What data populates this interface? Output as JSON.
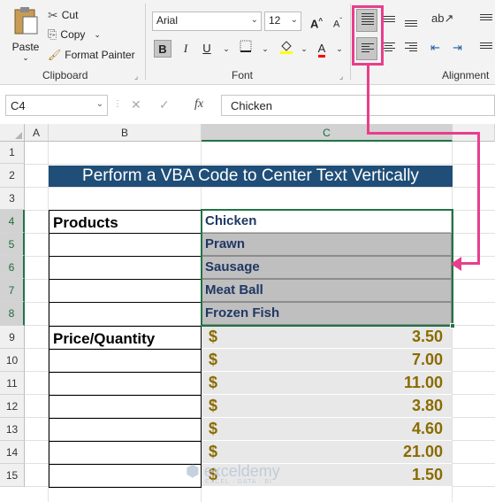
{
  "ribbon": {
    "clipboard": {
      "paste_label": "Paste",
      "cut_label": "Cut",
      "copy_label": "Copy",
      "format_painter_label": "Format Painter",
      "group_label": "Clipboard"
    },
    "font": {
      "font_name": "Arial",
      "font_size": "12",
      "bold": "B",
      "italic": "I",
      "underline": "U",
      "grow": "A",
      "shrink": "A",
      "font_color": "A",
      "group_label": "Font"
    },
    "alignment": {
      "group_label": "Alignment"
    }
  },
  "formula_bar": {
    "name_box": "C4",
    "fx": "fx",
    "formula": "Chicken"
  },
  "grid": {
    "columns": [
      "A",
      "B",
      "C"
    ],
    "rows": [
      "1",
      "2",
      "3",
      "4",
      "5",
      "6",
      "7",
      "8",
      "9",
      "10",
      "11",
      "12",
      "13",
      "14",
      "15"
    ]
  },
  "sheet": {
    "title": "Perform a VBA Code to Center Text Vertically",
    "products_label": "Products",
    "price_label": "Price/Quantity",
    "products": [
      "Chicken",
      "Prawn",
      "Sausage",
      "Meat Ball",
      "Frozen Fish"
    ],
    "currency": "$",
    "prices": [
      "3.50",
      "7.00",
      "11.00",
      "3.80",
      "4.60",
      "21.00",
      "1.50"
    ]
  },
  "watermark": {
    "brand": "exceldemy",
    "tagline": "EXCEL · DATA · BI"
  },
  "colors": {
    "title_bg": "#1f4e78",
    "accent_green": "#217346",
    "arrow_pink": "#e83e8c",
    "price_text": "#8a6b00"
  }
}
